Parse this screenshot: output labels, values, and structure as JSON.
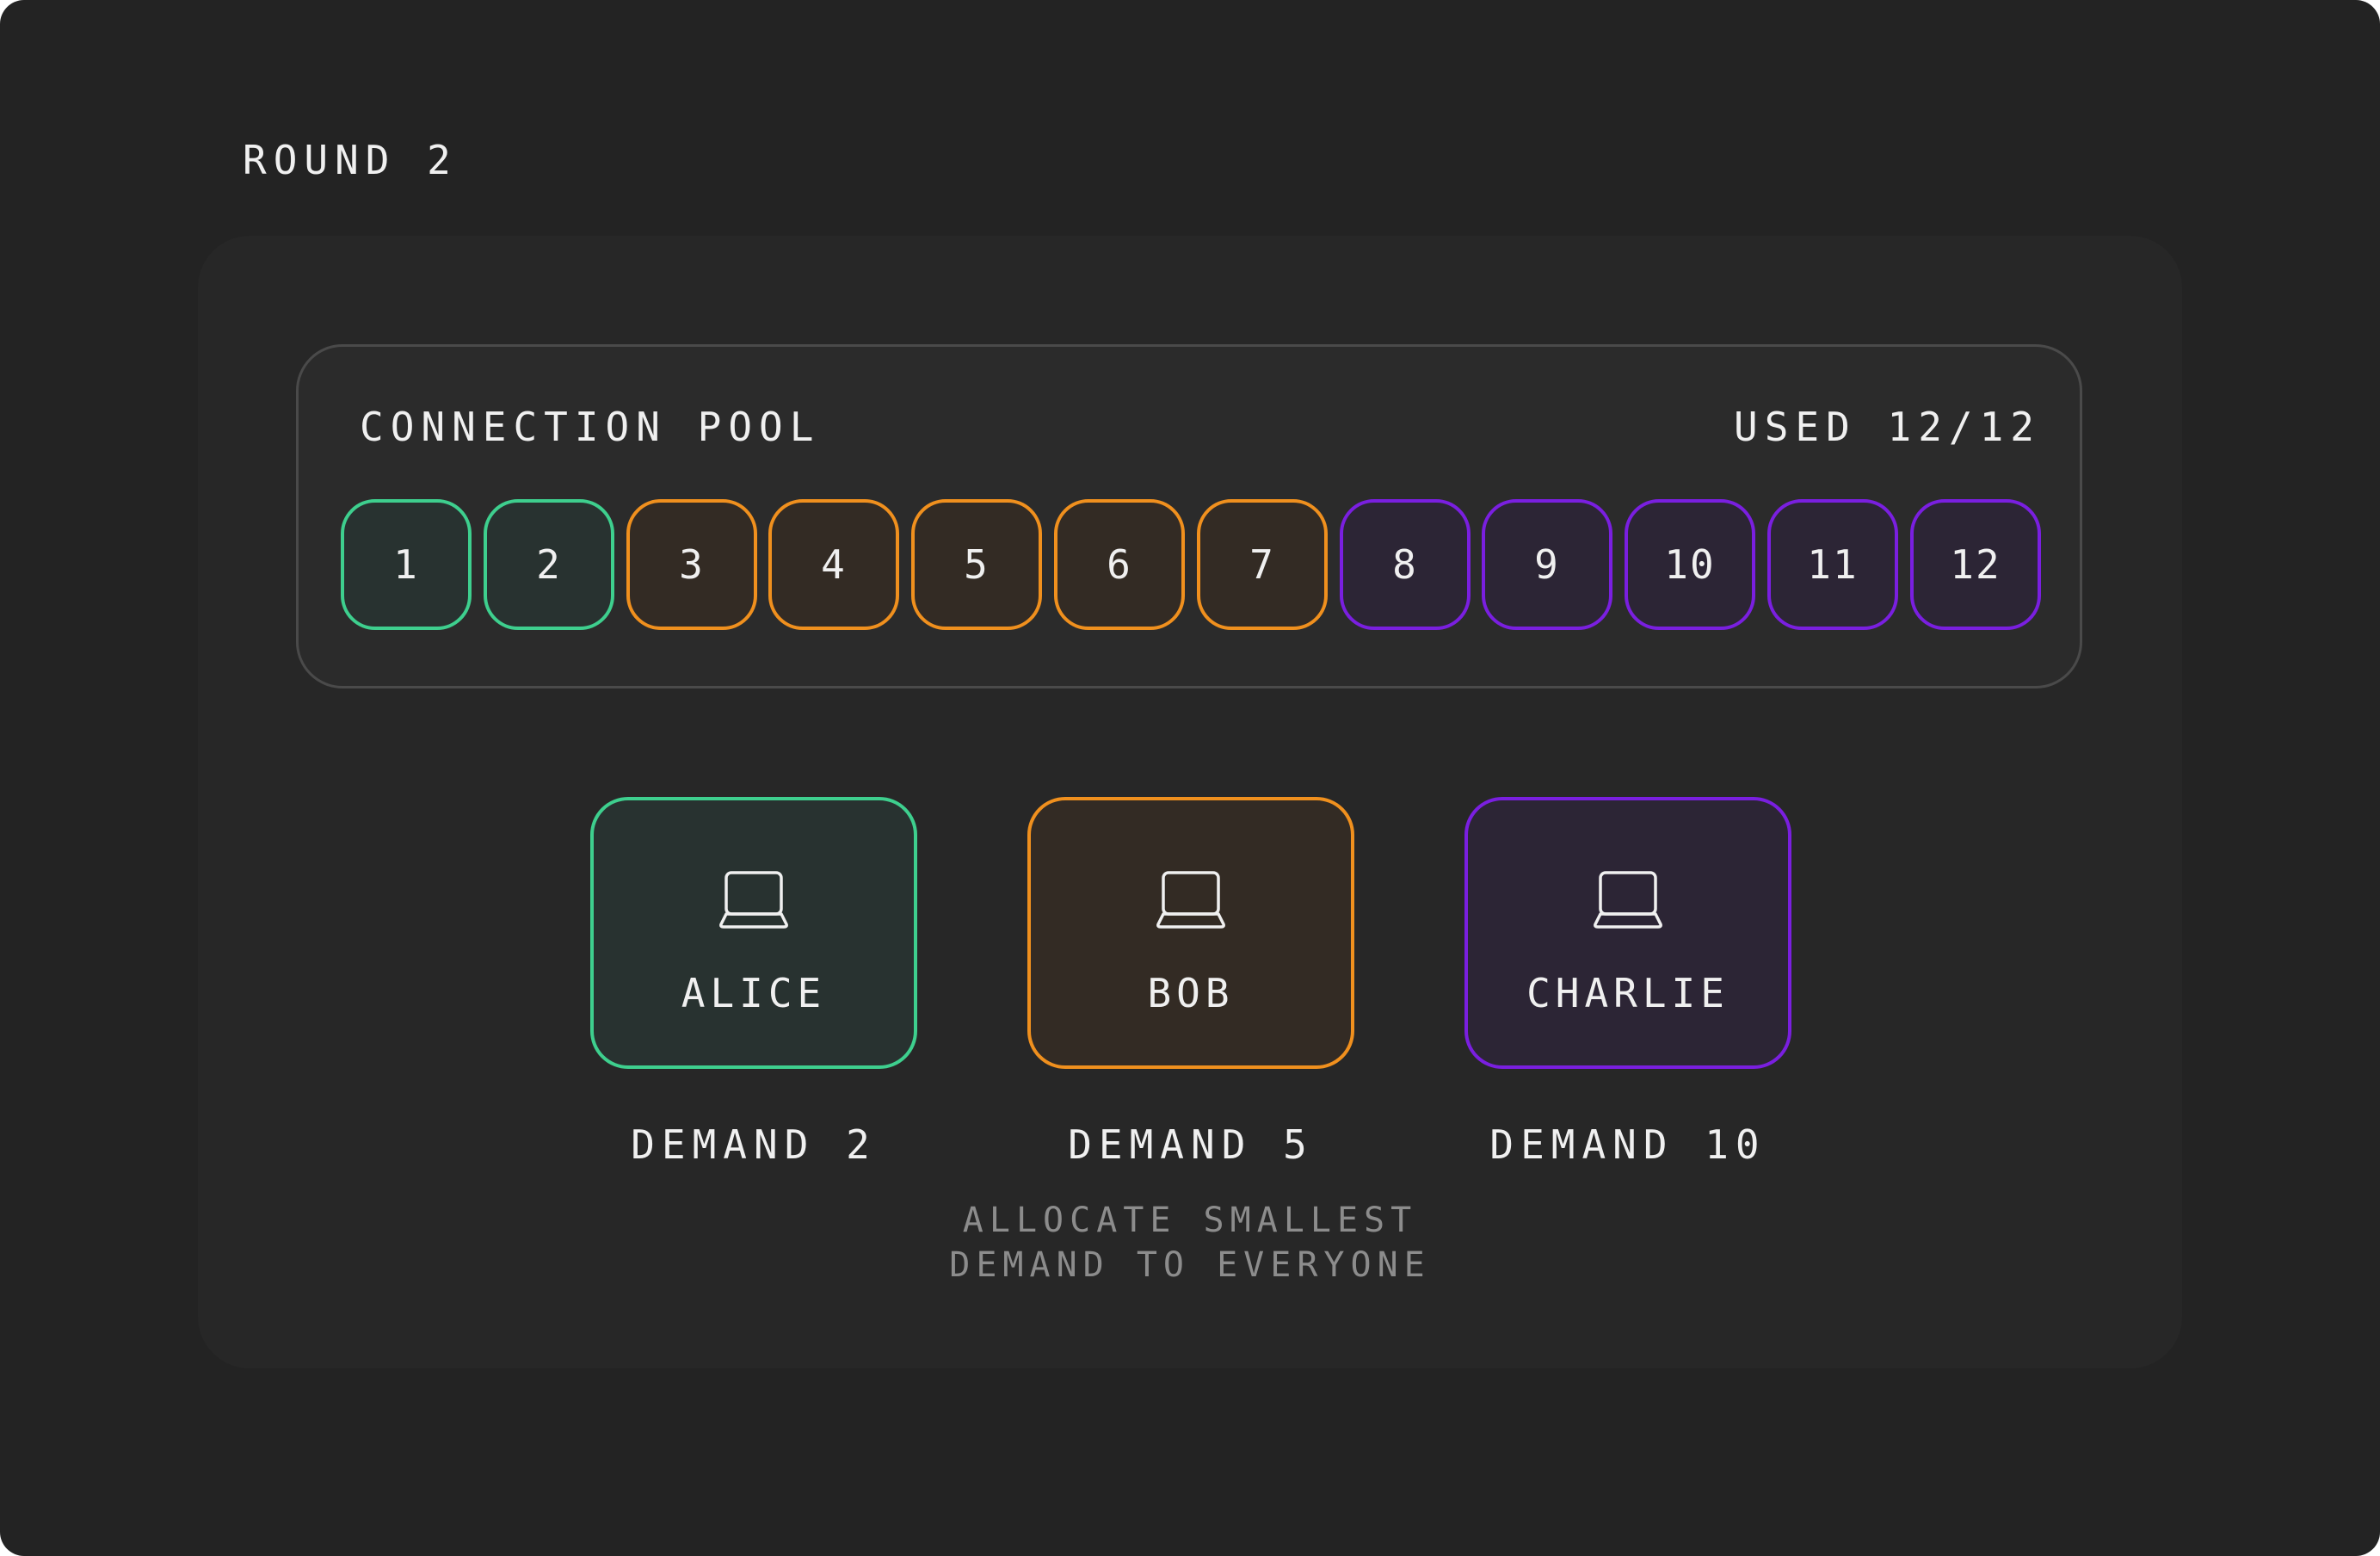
{
  "round_label": "ROUND 2",
  "pool": {
    "title": "CONNECTION POOL",
    "used": "USED 12/12",
    "slots": [
      "1",
      "2",
      "3",
      "4",
      "5",
      "6",
      "7",
      "8",
      "9",
      "10",
      "11",
      "12"
    ],
    "slot_owner": [
      "alice",
      "alice",
      "bob",
      "bob",
      "bob",
      "bob",
      "bob",
      "charlie",
      "charlie",
      "charlie",
      "charlie",
      "charlie"
    ]
  },
  "clients": [
    {
      "id": "alice",
      "name": "ALICE",
      "demand": "DEMAND 2",
      "icon": "laptop-icon"
    },
    {
      "id": "bob",
      "name": "BOB",
      "demand": "DEMAND 5",
      "icon": "laptop-icon"
    },
    {
      "id": "charlie",
      "name": "CHARLIE",
      "demand": "DEMAND 10",
      "icon": "laptop-icon"
    }
  ],
  "caption": [
    "ALLOCATE SMALLEST",
    "DEMAND TO EVERYONE"
  ],
  "colors": {
    "alice": {
      "border": "#3ecf8e",
      "fill": "#283230"
    },
    "bob": {
      "border": "#f0901e",
      "fill": "#332b24"
    },
    "charlie": {
      "border": "#7a1fe0",
      "fill": "#2c2535"
    }
  }
}
